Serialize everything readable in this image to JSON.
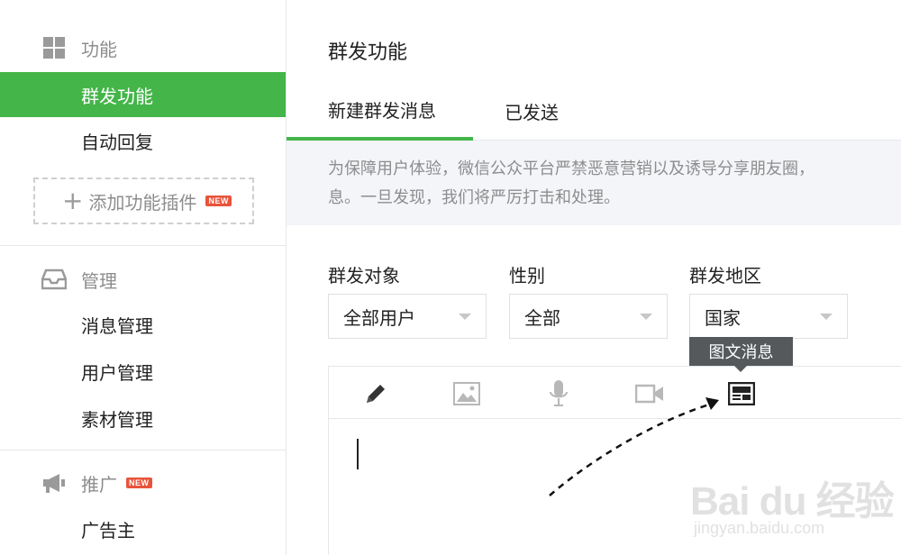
{
  "sidebar": {
    "sections": [
      {
        "icon": "grid-icon",
        "label": "功能",
        "items": [
          {
            "label": "群发功能",
            "active": true
          },
          {
            "label": "自动回复",
            "active": false
          }
        ],
        "add_plugin": {
          "label": "添加功能插件",
          "badge": "NEW"
        }
      },
      {
        "icon": "inbox-icon",
        "label": "管理",
        "items": [
          {
            "label": "消息管理"
          },
          {
            "label": "用户管理"
          },
          {
            "label": "素材管理"
          }
        ]
      },
      {
        "icon": "megaphone-icon",
        "label": "推广",
        "badge": "NEW",
        "items": [
          {
            "label": "广告主"
          }
        ]
      }
    ]
  },
  "main": {
    "title": "群发功能",
    "tabs": [
      {
        "label": "新建群发消息",
        "active": true
      },
      {
        "label": "已发送",
        "active": false
      }
    ],
    "notice": {
      "line1": "为保障用户体验，微信公众平台严禁恶意营销以及诱导分享朋友圈，",
      "line2": "息。一旦发现，我们将严厉打击和处理。"
    },
    "filters": [
      {
        "label": "群发对象",
        "value": "全部用户"
      },
      {
        "label": "性别",
        "value": "全部"
      },
      {
        "label": "群发地区",
        "value": "国家"
      }
    ],
    "toolbar": {
      "tools": [
        {
          "icon": "pencil-icon",
          "name": "text"
        },
        {
          "icon": "image-icon",
          "name": "image"
        },
        {
          "icon": "microphone-icon",
          "name": "voice"
        },
        {
          "icon": "video-icon",
          "name": "video"
        },
        {
          "icon": "news-icon",
          "name": "news"
        }
      ],
      "tooltip": "图文消息"
    }
  },
  "watermark": {
    "brand": "Bai du 经验",
    "url": "jingyan.baidu.com"
  },
  "colors": {
    "accent": "#44b549",
    "badge": "#e8533b",
    "notice_bg": "#f4f5f9",
    "tooltip_bg": "#55595c",
    "muted": "#8d8d8d"
  }
}
